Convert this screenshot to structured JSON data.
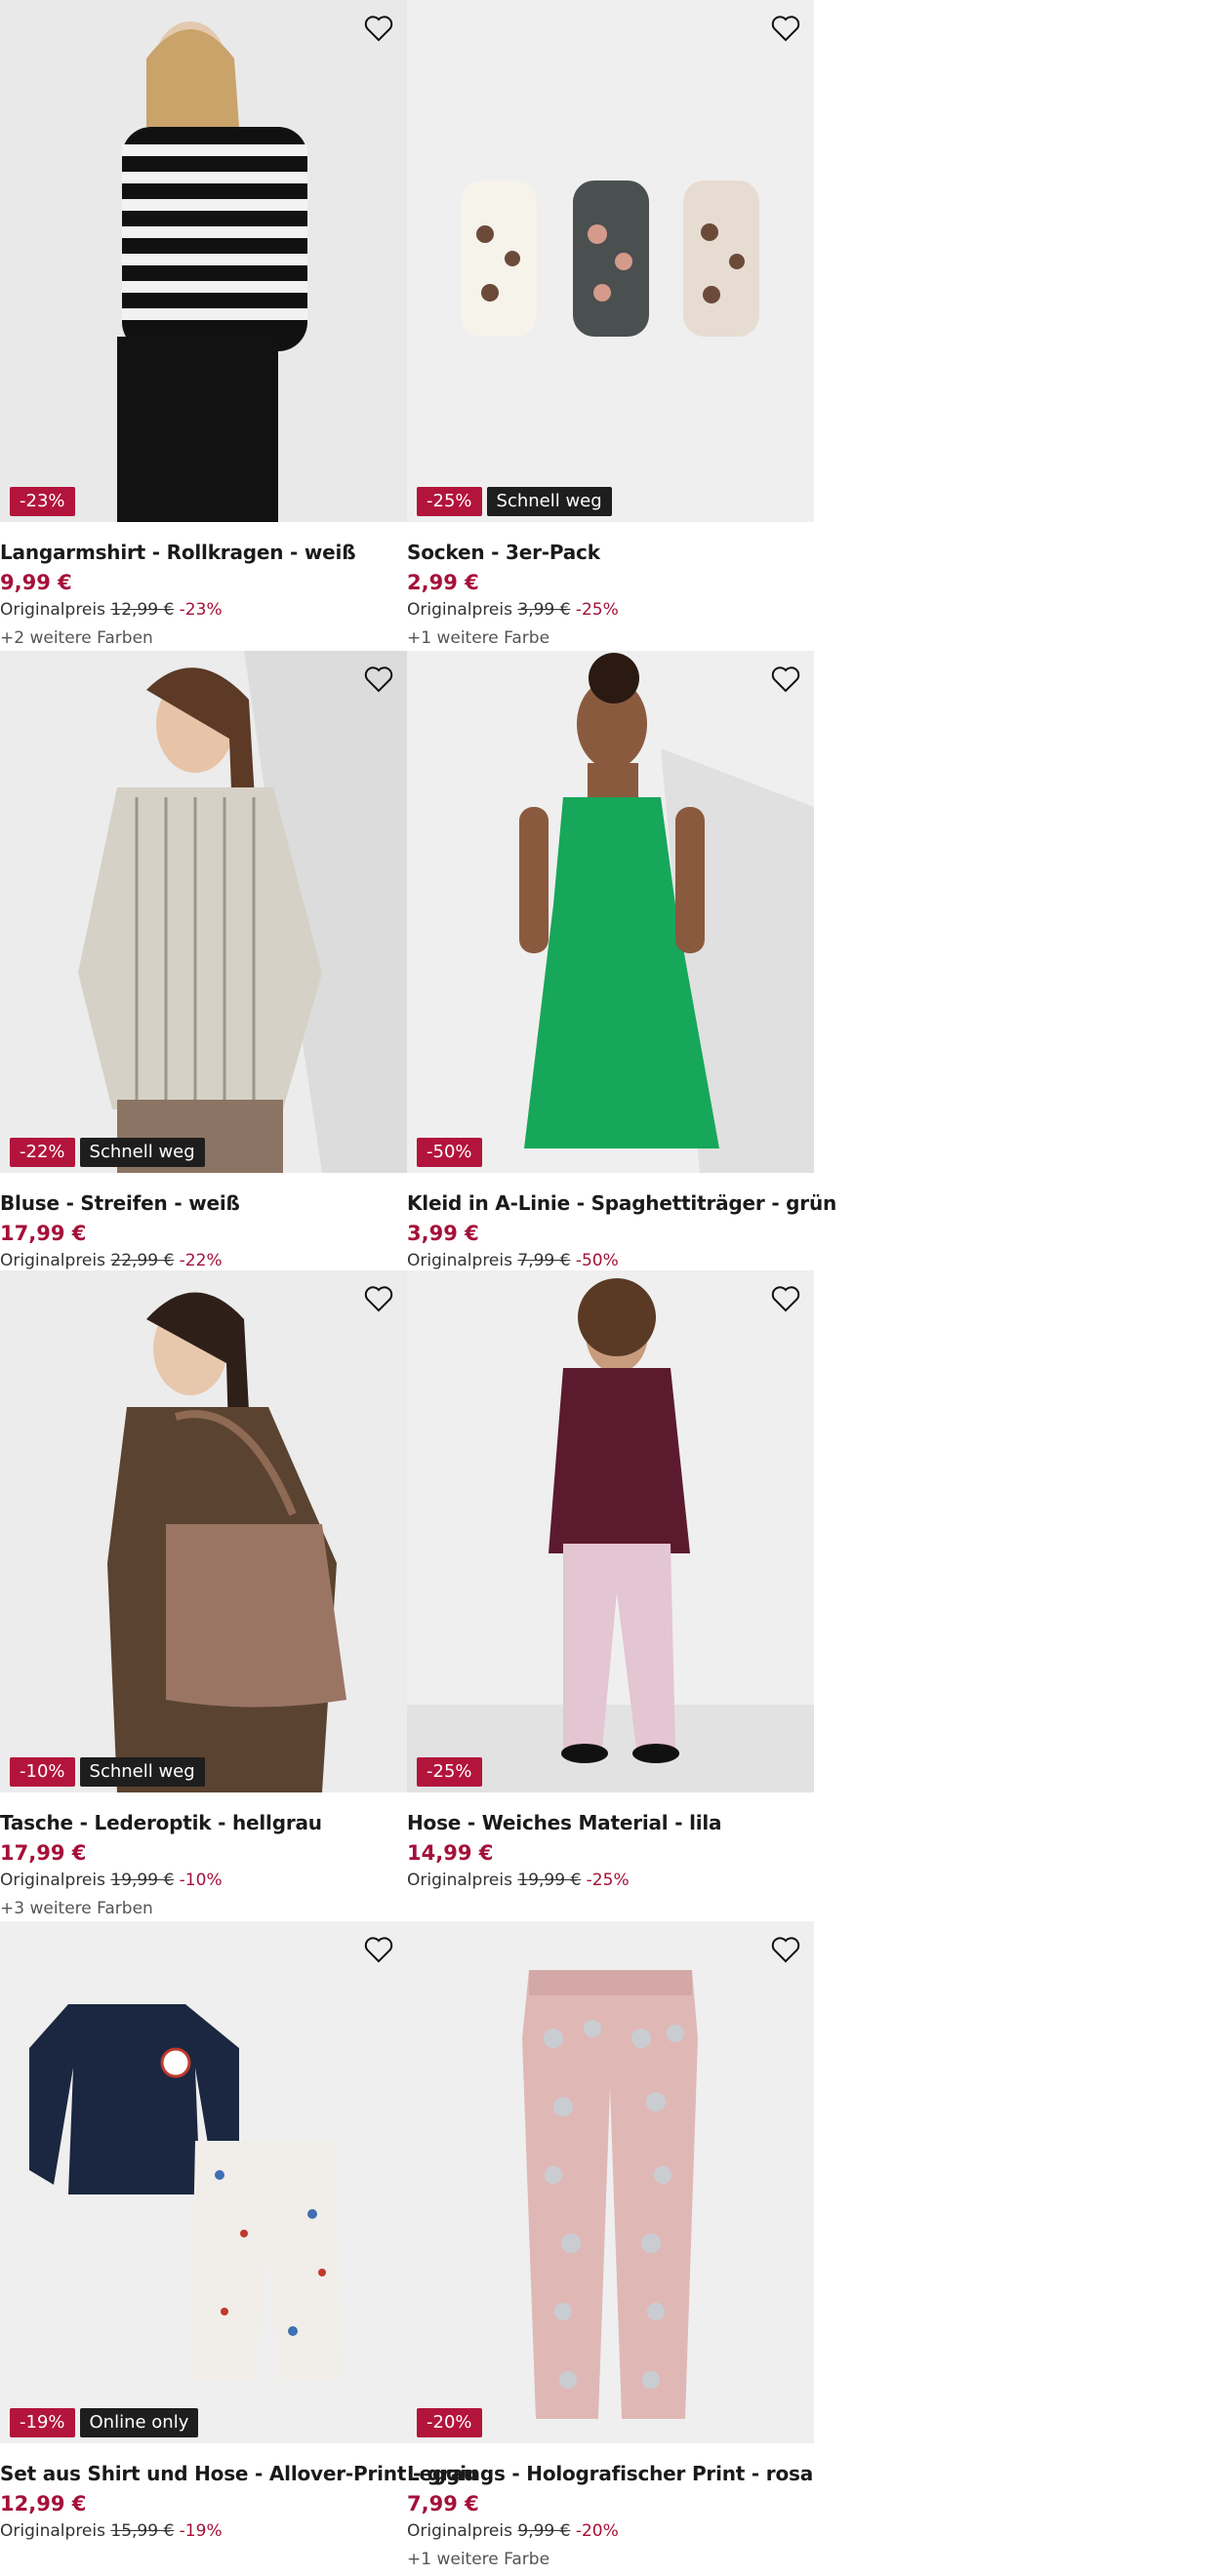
{
  "products": [
    {
      "title": "Langarmshirt - Rollkragen - weiß",
      "price": "9,99 €",
      "orig_label": "Originalpreis",
      "orig_price": "12,99 €",
      "discount": "-23%",
      "badges": [
        "-23%"
      ],
      "more_colors": "+2 weitere Farben"
    },
    {
      "title": "Socken - 3er-Pack",
      "price": "2,99 €",
      "orig_label": "Originalpreis",
      "orig_price": "3,99 €",
      "discount": "-25%",
      "badges": [
        "-25%",
        "Schnell weg"
      ],
      "more_colors": "+1 weitere Farbe"
    },
    {
      "title": "Bluse - Streifen - weiß",
      "price": "17,99 €",
      "orig_label": "Originalpreis",
      "orig_price": "22,99 €",
      "discount": "-22%",
      "badges": [
        "-22%",
        "Schnell weg"
      ],
      "more_colors": ""
    },
    {
      "title": "Kleid in A-Linie - Spaghettiträger - grün",
      "price": "3,99 €",
      "orig_label": "Originalpreis",
      "orig_price": "7,99 €",
      "discount": "-50%",
      "badges": [
        "-50%"
      ],
      "more_colors": ""
    },
    {
      "title": "Tasche - Lederoptik - hellgrau",
      "price": "17,99 €",
      "orig_label": "Originalpreis",
      "orig_price": "19,99 €",
      "discount": "-10%",
      "badges": [
        "-10%",
        "Schnell weg"
      ],
      "more_colors": "+3 weitere Farben"
    },
    {
      "title": "Hose - Weiches Material - lila",
      "price": "14,99 €",
      "orig_label": "Originalpreis",
      "orig_price": "19,99 €",
      "discount": "-25%",
      "badges": [
        "-25%"
      ],
      "more_colors": ""
    },
    {
      "title": "Set aus Shirt und Hose - Allover-Print - grau",
      "price": "12,99 €",
      "orig_label": "Originalpreis",
      "orig_price": "15,99 €",
      "discount": "-19%",
      "badges": [
        "-19%",
        "Online only"
      ],
      "more_colors": ""
    },
    {
      "title": "Leggings - Holografischer Print - rosa",
      "price": "7,99 €",
      "orig_label": "Originalpreis",
      "orig_price": "9,99 €",
      "discount": "-20%",
      "badges": [
        "-20%"
      ],
      "more_colors": "+1 weitere Farbe"
    }
  ],
  "icons": {
    "favorite": "heart-outline-icon"
  },
  "colors": {
    "sale": "#b3143c",
    "price": "#a5103a",
    "dark_badge": "#1e1e1e",
    "image_bg": "#efefef"
  }
}
